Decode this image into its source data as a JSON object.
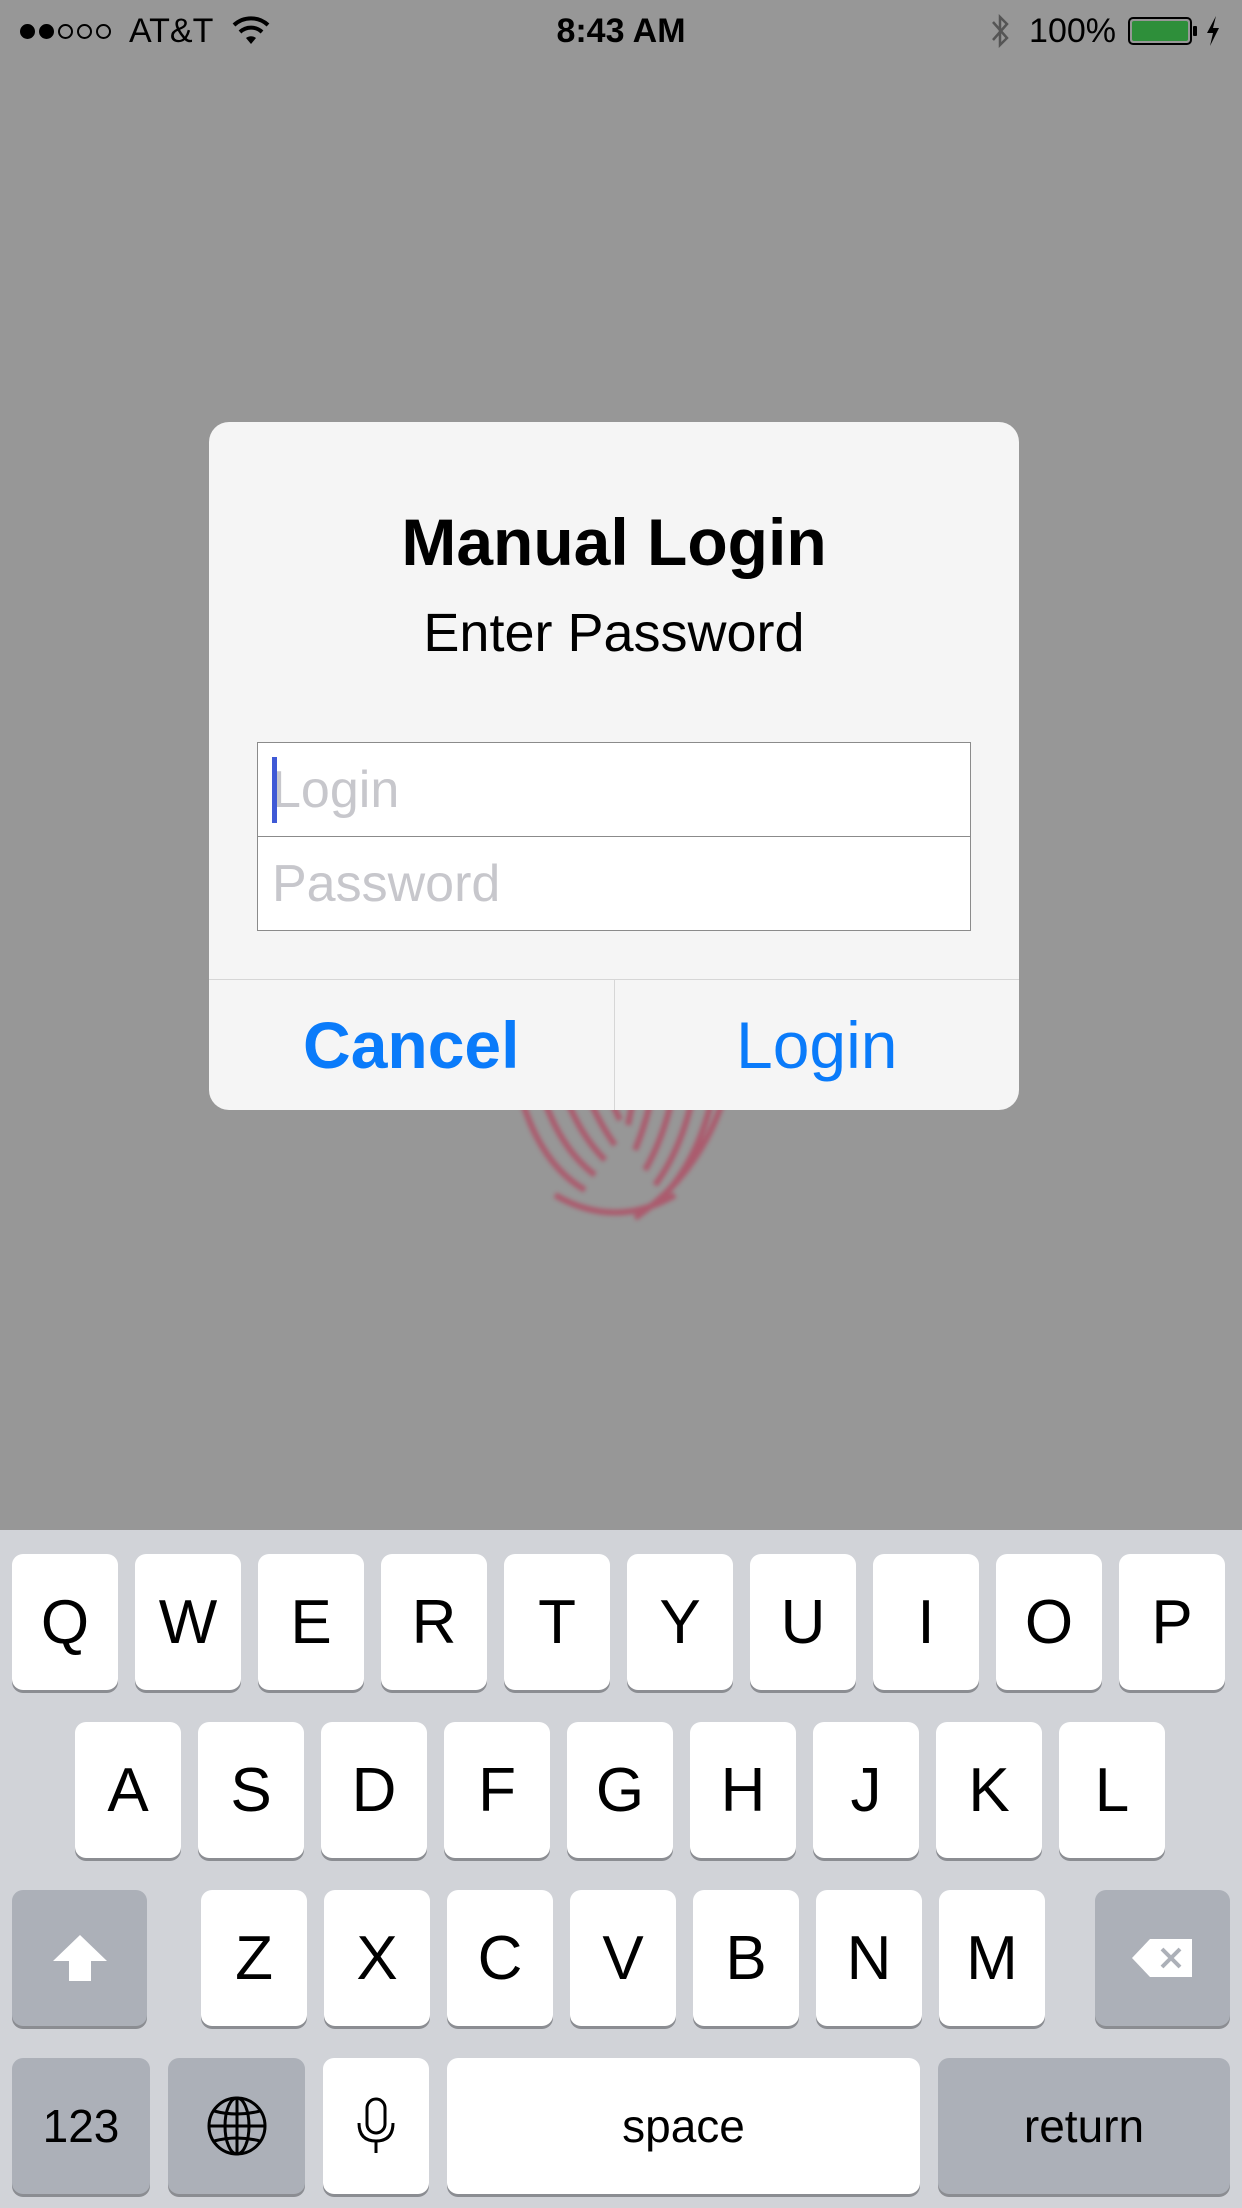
{
  "status_bar": {
    "signal_bars_filled": 2,
    "signal_bars_total": 5,
    "carrier": "AT&T",
    "time": "8:43 AM",
    "battery_percent": "100%"
  },
  "alert": {
    "title": "Manual Login",
    "message": "Enter Password",
    "login_placeholder": "Login",
    "password_placeholder": "Password",
    "cancel_label": "Cancel",
    "login_label": "Login"
  },
  "keyboard": {
    "row1": [
      "Q",
      "W",
      "E",
      "R",
      "T",
      "Y",
      "U",
      "I",
      "O",
      "P"
    ],
    "row2": [
      "A",
      "S",
      "D",
      "F",
      "G",
      "H",
      "J",
      "K",
      "L"
    ],
    "row3": [
      "Z",
      "X",
      "C",
      "V",
      "B",
      "N",
      "M"
    ],
    "numbers_label": "123",
    "space_label": "space",
    "return_label": "return"
  },
  "colors": {
    "accent": "#0a7bfa",
    "dim_background": "#979797",
    "keyboard_background": "#d1d3d8",
    "battery_fill": "#2e8f3a",
    "fingerprint": "#b24760"
  },
  "icons": [
    "wifi-icon",
    "bluetooth-icon",
    "battery-icon",
    "charging-bolt-icon",
    "fingerprint-icon",
    "shift-icon",
    "delete-icon",
    "globe-icon",
    "microphone-icon"
  ]
}
